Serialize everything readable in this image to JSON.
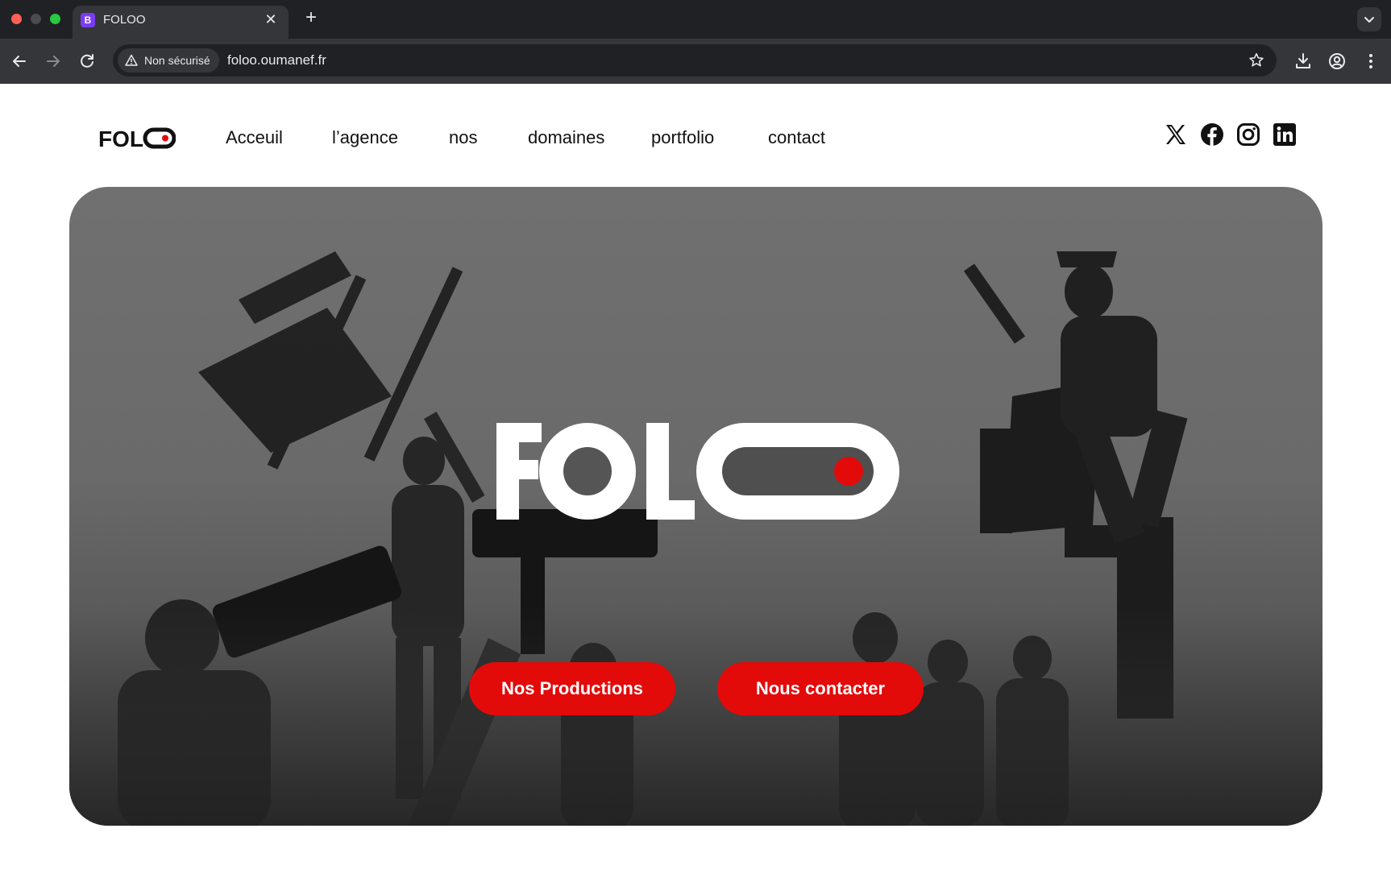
{
  "browser": {
    "tab": {
      "favicon_letter": "B",
      "title": "FOLOO",
      "close_glyph": "✕"
    },
    "new_tab_glyph": "+",
    "security_label": "Non sécurisé",
    "url": "foloo.oumanef.fr"
  },
  "site": {
    "logo_text": "FOLOO",
    "nav": [
      "Acceuil",
      "l’agence",
      "nos",
      "domaines",
      "portfolio",
      "contact"
    ],
    "socials": [
      "x-icon",
      "facebook-icon",
      "instagram-icon",
      "linkedin-icon"
    ],
    "hero": {
      "brand": "FOLOO",
      "buttons": {
        "primary": "Nos Productions",
        "secondary": "Nous contacter"
      }
    },
    "colors": {
      "accent": "#e30a0a",
      "text": "#111111",
      "chrome": "#202124"
    }
  }
}
